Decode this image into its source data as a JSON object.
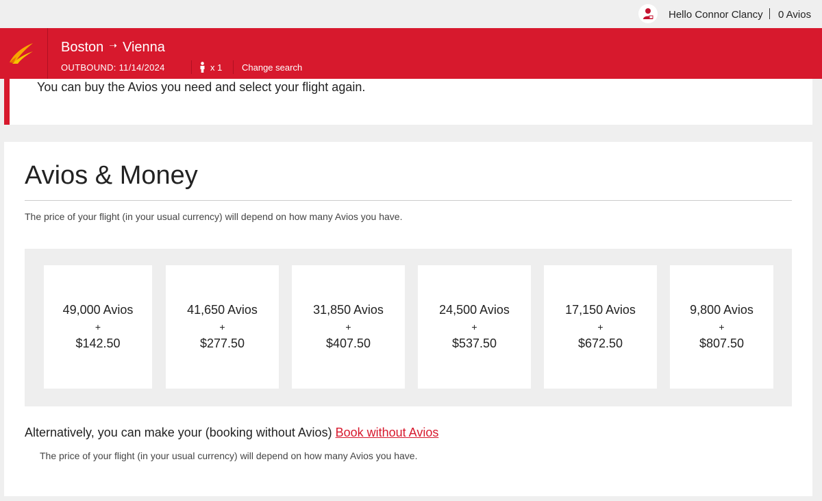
{
  "user": {
    "greeting": "Hello Connor Clancy",
    "avios_balance": "0 Avios"
  },
  "header": {
    "origin": "Boston",
    "destination": "Vienna",
    "outbound": "OUTBOUND: 11/14/2024",
    "passengers": "x 1",
    "change_search": "Change search",
    "brand_color": "#d7192d"
  },
  "info": {
    "message": "You can buy the Avios you need and select your flight again."
  },
  "main": {
    "title": "Avios & Money",
    "subtitle": "The price of your flight (in your usual currency) will depend on how many Avios you have.",
    "options": [
      {
        "avios": "49,000 Avios",
        "plus": "+",
        "money": "$142.50"
      },
      {
        "avios": "41,650 Avios",
        "plus": "+",
        "money": "$277.50"
      },
      {
        "avios": "31,850 Avios",
        "plus": "+",
        "money": "$407.50"
      },
      {
        "avios": "24,500 Avios",
        "plus": "+",
        "money": "$537.50"
      },
      {
        "avios": "17,150 Avios",
        "plus": "+",
        "money": "$672.50"
      },
      {
        "avios": "9,800 Avios",
        "plus": "+",
        "money": "$807.50"
      }
    ],
    "alternative_text": "Alternatively, you can make your (booking without Avios)",
    "alternative_link": "Book without Avios",
    "alternative_sub": "The price of your flight (in your usual currency) will depend on how many Avios you have."
  }
}
